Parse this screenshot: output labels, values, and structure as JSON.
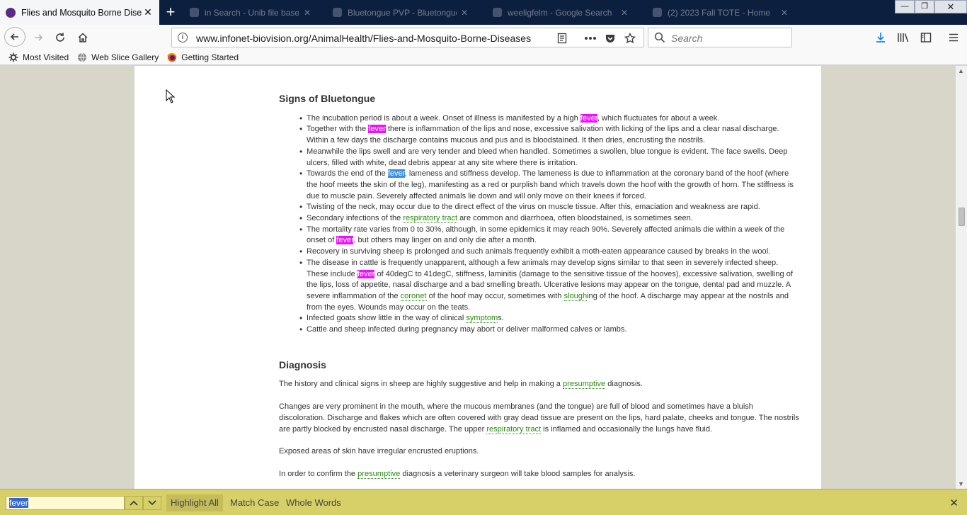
{
  "browser": {
    "active_tab": {
      "title": "Flies and Mosquito Borne Diseases"
    },
    "background_tabs": [
      {
        "title": "in Search - Unib file based on o"
      },
      {
        "title": "Bluetongue PVP - Bluetongue (BLU..."
      },
      {
        "title": "weeligfelm - Google Search"
      },
      {
        "title": "(2) 2023 Fall TOTE - Home"
      }
    ],
    "new_tab_label": "+",
    "window_controls": {
      "minimize": "—",
      "maximize": "❐",
      "close": "✕"
    },
    "url": "www.infonet-biovision.org/AnimalHealth/Flies-and-Mosquito-Borne-Diseases",
    "search_placeholder": "Search",
    "bookmarks": [
      {
        "label": "Most Visited",
        "icon": "gear-icon"
      },
      {
        "label": "Web Slice Gallery",
        "icon": "globe-icon"
      },
      {
        "label": "Getting Started",
        "icon": "firefox-icon"
      }
    ]
  },
  "page": {
    "signs_heading": "Signs of Bluetongue",
    "signs": [
      {
        "parts": [
          {
            "t": "The incubation period is about a week. Onset of illness is manifested by a high "
          },
          {
            "t": "fever",
            "hl": "find"
          },
          {
            "t": ", which fluctuates for about a week."
          }
        ]
      },
      {
        "parts": [
          {
            "t": "Together with the "
          },
          {
            "t": "fever",
            "hl": "find"
          },
          {
            "t": " there is inflammation of the lips and nose, excessive salivation with licking of the lips and a clear nasal discharge. Within a few days the discharge contains mucous and pus and is bloodstained. It then dries, encrusting the nostrils."
          }
        ]
      },
      {
        "parts": [
          {
            "t": "Meanwhile the lips swell and are very tender and bleed when handled. Sometimes a swollen, blue tongue is evident. The face swells. Deep ulcers, filled with white, dead debris appear at any site where there is irritation."
          }
        ]
      },
      {
        "parts": [
          {
            "t": "Towards the end of the "
          },
          {
            "t": "fever",
            "hl": "selected"
          },
          {
            "t": ", lameness and stiffness develop. The lameness is due to inflammation at the coronary band of the hoof (where the hoof meets the skin of the leg), manifesting as a red or purplish band which travels down the hoof with the growth of horn. The stiffness is due to muscle pain. Severely affected animals lie down and will only move on their knees if forced."
          }
        ]
      },
      {
        "parts": [
          {
            "t": "Twisting of the neck, may occur due to the direct effect of the virus on muscle tissue. After this, emaciation and weakness are rapid."
          }
        ]
      },
      {
        "parts": [
          {
            "t": "Secondary infections of the "
          },
          {
            "t": "respiratory tract",
            "link": true
          },
          {
            "t": " are common and diarrhoea, often bloodstained, is sometimes seen."
          }
        ]
      },
      {
        "parts": [
          {
            "t": "The mortality rate varies from 0 to 30%, although, in some epidemics it may reach 90%. Severely affected animals die within a week of the onset of "
          },
          {
            "t": "fever",
            "hl": "find"
          },
          {
            "t": ", but others may linger on and only die after a month."
          }
        ]
      },
      {
        "parts": [
          {
            "t": "Recovery in surviving sheep is prolonged and such animals frequently exhibit a moth-eaten appearance caused by breaks in the wool."
          }
        ]
      },
      {
        "parts": [
          {
            "t": "The disease in cattle is frequently unapparent, although a few animals may develop signs similar to that seen in severely infected sheep. These include "
          },
          {
            "t": "fever",
            "hl": "find"
          },
          {
            "t": " of 40degC to 41degC, stiffness, laminitis (damage to the sensitive tissue of the hooves), excessive salivation, swelling of the lips, loss of appetite, nasal discharge and a bad smelling breath. Ulcerative lesions may appear on the tongue, dental pad and muzzle. A severe inflammation of the "
          },
          {
            "t": "coronet",
            "link": true
          },
          {
            "t": " of the hoof may occur, sometimes with "
          },
          {
            "t": "slough",
            "link": true
          },
          {
            "t": "ing of the hoof. A discharge may appear at the nostrils and from the eyes. Wounds may occur on the teats."
          }
        ]
      },
      {
        "parts": [
          {
            "t": "Infected goats show little in the way of clinical "
          },
          {
            "t": "symptom",
            "link": true
          },
          {
            "t": "s."
          }
        ]
      },
      {
        "parts": [
          {
            "t": "Cattle and sheep infected during pregnancy may abort or deliver malformed calves or lambs."
          }
        ]
      }
    ],
    "diagnosis_heading": "Diagnosis",
    "diagnosis": [
      {
        "parts": [
          {
            "t": "The history and clinical signs in sheep are highly suggestive and help in making a "
          },
          {
            "t": "presumptive",
            "link": true
          },
          {
            "t": " diagnosis."
          }
        ]
      },
      {
        "parts": [
          {
            "t": "Changes are very prominent in the mouth, where the mucous membranes (and the tongue) are full of blood and sometimes have a bluish discoloration. Discharge and flakes which are often covered with gray dead tissue are present on the lips, hard palate, cheeks and tongue. The nostrils are partly blocked by encrusted nasal discharge. The upper "
          },
          {
            "t": "respiratory tract",
            "link": true
          },
          {
            "t": " is inflamed and occasionally the lungs have fluid."
          }
        ]
      },
      {
        "parts": [
          {
            "t": "Exposed areas of skin have irregular encrusted eruptions."
          }
        ]
      },
      {
        "parts": [
          {
            "t": "In order to confirm the "
          },
          {
            "t": "presumptive",
            "link": true
          },
          {
            "t": " diagnosis a veterinary surgeon will take blood samples for analysis."
          }
        ]
      }
    ]
  },
  "findbar": {
    "query": "fever",
    "highlight_all_label": "Highlight All",
    "match_case_label": "Match Case",
    "whole_words_label": "Whole Words",
    "highlight_all_active": true
  },
  "colors": {
    "find_highlight": "#ef0fff",
    "selected_highlight": "#3b8ee6",
    "link": "#2b8a12",
    "findbar_bg": "#d7d068"
  }
}
